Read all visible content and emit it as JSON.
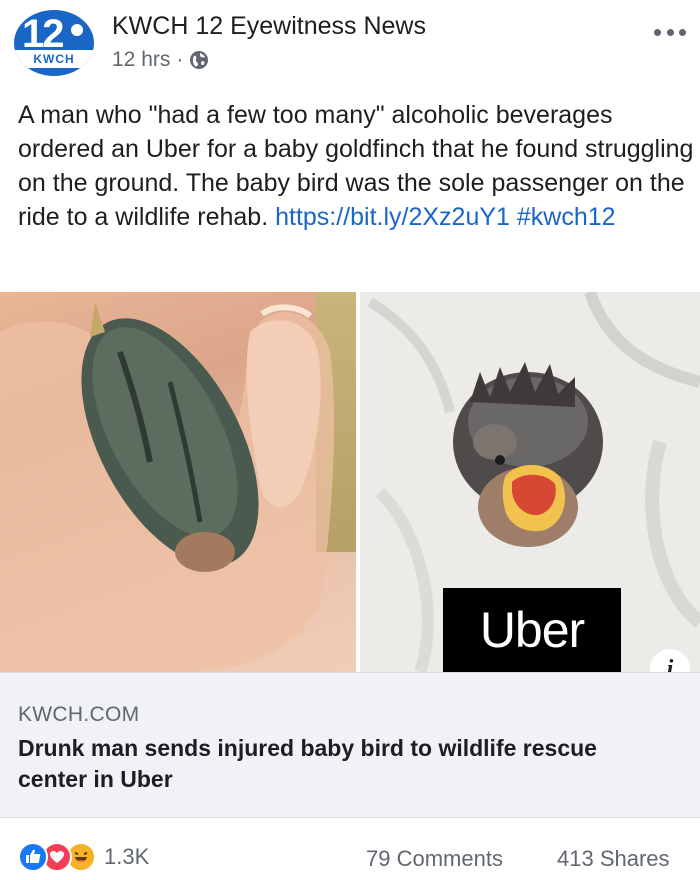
{
  "post": {
    "page_name": "KWCH 12 Eyewitness News",
    "time": "12 hrs",
    "separator": "·",
    "avatar": {
      "number": "12",
      "band": "KWCH"
    },
    "caption": "A man who \"had a few too many\" alcoholic beverages ordered an Uber for a baby goldfinch that he found struggling on the ground. The baby bird was the sole passenger on the ride to a wildlife rehab. ",
    "caption_link": "https://bit.ly/2Xz2uY1",
    "caption_hashtag": "#kwch12"
  },
  "media": {
    "logo_text": "Uber",
    "info_label": "i"
  },
  "link_preview": {
    "domain": "KWCH.COM",
    "title": "Drunk man sends injured baby bird to wildlife rescue center in Uber"
  },
  "footer": {
    "reactions_count": "1.3K",
    "comments": "79 Comments",
    "shares": "413 Shares"
  },
  "colors": {
    "link": "#1a66c7",
    "brand": "#1a66c7",
    "like": "#1877f2",
    "love": "#f33e58",
    "haha": "#f7b125"
  },
  "icons": [
    "globe-icon",
    "more-options-icon",
    "info-icon",
    "like-reaction-icon",
    "love-reaction-icon",
    "haha-reaction-icon"
  ]
}
